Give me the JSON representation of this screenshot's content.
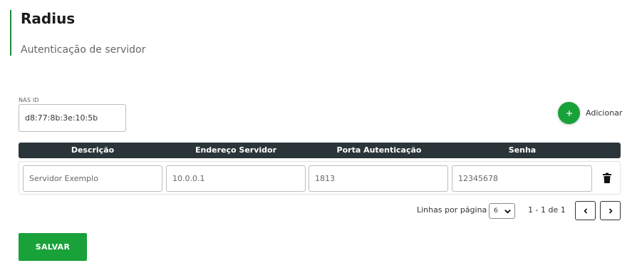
{
  "header": {
    "title": "Radius",
    "subtitle": "Autenticação de servidor"
  },
  "nas": {
    "label": "NAS ID",
    "value": "d8:77:8b:3e:10:5b"
  },
  "add": {
    "icon": "plus-icon",
    "label": "Adicionar"
  },
  "table": {
    "columns": [
      "Descrição",
      "Endereço Servidor",
      "Porta Autenticação",
      "Senha"
    ],
    "rows": [
      {
        "descricao": "Servidor Exemplo",
        "endereco": "10.0.0.1",
        "porta": "1813",
        "senha": "12345678"
      }
    ]
  },
  "pagination": {
    "rows_label": "Linhas por página",
    "rows_per_page": "6",
    "range": "1 - 1 de 1"
  },
  "save": {
    "label": "SALVAR"
  },
  "colors": {
    "accent": "#19a13a",
    "header_bg": "#2b3539"
  }
}
